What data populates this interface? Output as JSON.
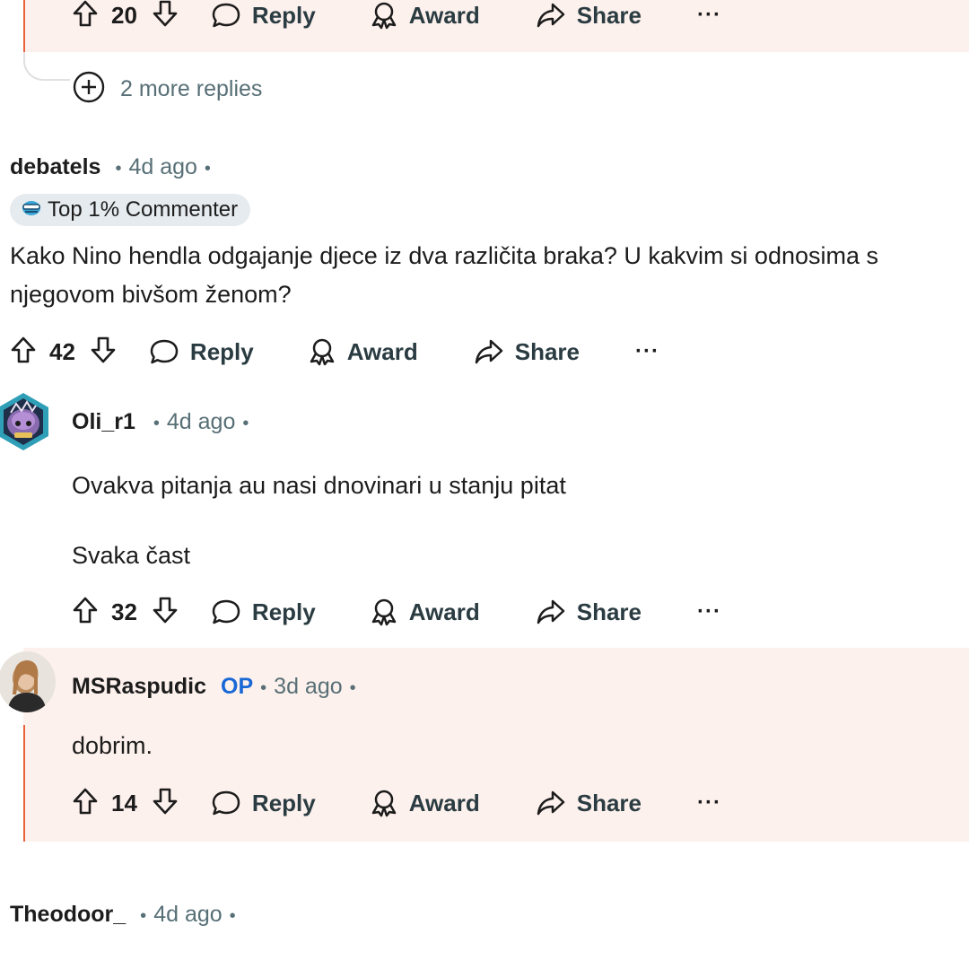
{
  "top_comment": {
    "score": "20",
    "reply_label": "Reply",
    "award_label": "Award",
    "share_label": "Share",
    "more_label": "···",
    "more_replies": "2 more replies"
  },
  "comment_debatels": {
    "username": "debatels",
    "time": "4d ago",
    "flair_text": "Top 1% Commenter",
    "body_line1": "Kako Nino hendla odgajanje djece iz dva različita braka? U kakvim si odnosima s",
    "body_line2": "njegovom bivšom ženom?",
    "score": "42",
    "reply_label": "Reply",
    "award_label": "Award",
    "share_label": "Share",
    "more_label": "···"
  },
  "comment_olir1": {
    "username": "Oli_r1",
    "time": "4d ago",
    "body_para1": "Ovakva pitanja au nasi dnovinari u stanju pitat",
    "body_para2": "Svaka čast",
    "score": "32",
    "reply_label": "Reply",
    "award_label": "Award",
    "share_label": "Share",
    "more_label": "···"
  },
  "comment_msraspudic": {
    "username": "MSRaspudic",
    "op_badge": "OP",
    "time": "3d ago",
    "body": "dobrim.",
    "score": "14",
    "reply_label": "Reply",
    "award_label": "Award",
    "share_label": "Share",
    "more_label": "···"
  },
  "comment_theodoor": {
    "username": "Theodoor_",
    "time": "4d ago"
  },
  "colors": {
    "op_highlight_bg": "#fdf1ed",
    "op_line": "#e8623a",
    "op_badge": "#1868d6",
    "meta_text": "#576f76"
  },
  "icons": [
    "upvote-icon",
    "downvote-icon",
    "reply-bubble-icon",
    "award-icon",
    "share-icon",
    "more-icon",
    "expand-plus-icon",
    "commenter-flair-icon"
  ]
}
